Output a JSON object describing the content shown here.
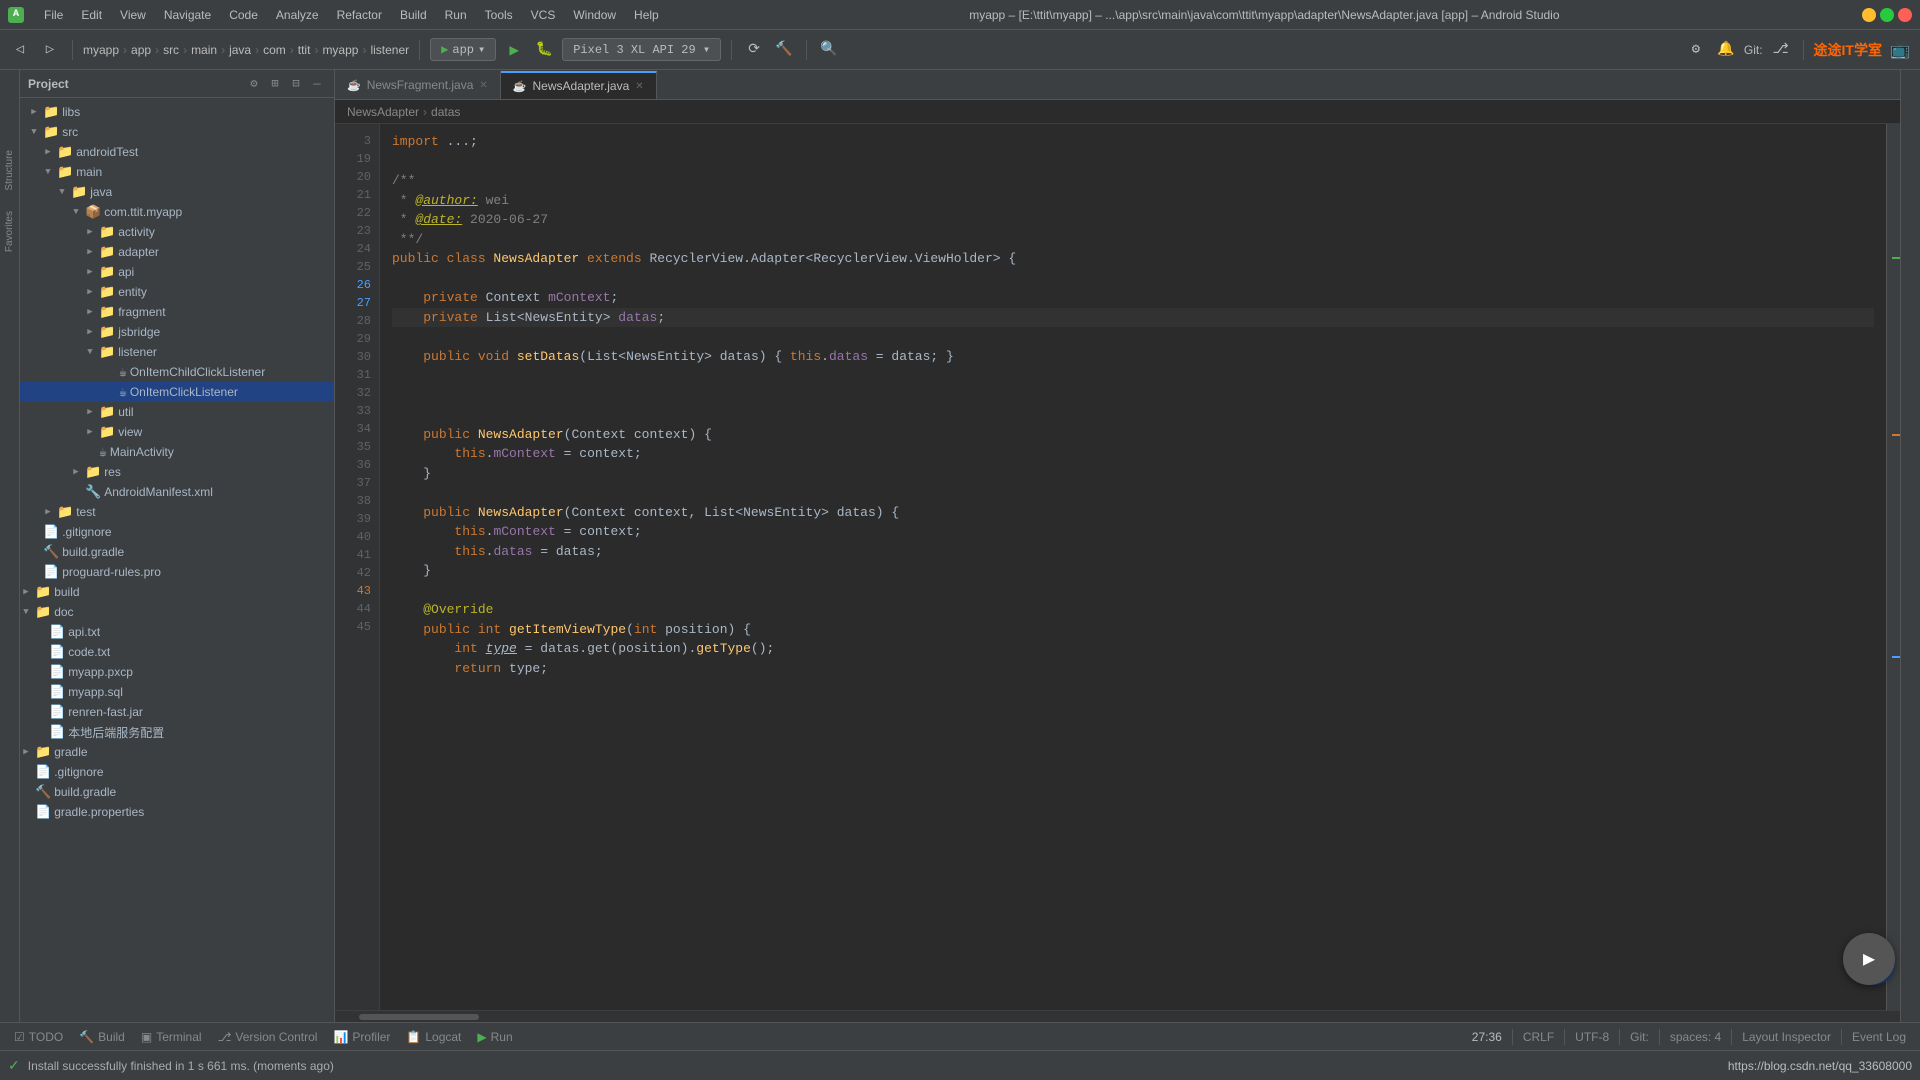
{
  "titlebar": {
    "menus": [
      "File",
      "Edit",
      "View",
      "Navigate",
      "Code",
      "Analyze",
      "Refactor",
      "Build",
      "Run",
      "Tools",
      "VCS",
      "Window",
      "Help"
    ],
    "title": "myapp – [E:\\ttit\\myapp] – ...\\app\\src\\main\\java\\com\\ttit\\myapp\\adapter\\NewsAdapter.java [app] – Android Studio",
    "wc_min": "—",
    "wc_max": "□",
    "wc_close": "✕"
  },
  "toolbar": {
    "app_config": "app",
    "device": "Pixel 3 XL API 29",
    "git_label": "Git:",
    "breadcrumb": [
      "myapp",
      "app",
      "src",
      "main",
      "java",
      "com",
      "ttit",
      "myapp",
      "listener"
    ]
  },
  "tabs": [
    {
      "name": "NewsFragment.java",
      "active": false,
      "modified": false
    },
    {
      "name": "NewsAdapter.java",
      "active": true,
      "modified": false
    }
  ],
  "code_breadcrumb": {
    "parts": [
      "NewsAdapter",
      "datas"
    ]
  },
  "sidebar": {
    "title": "Project",
    "tree": [
      {
        "indent": 0,
        "type": "folder",
        "expanded": true,
        "name": "libs",
        "icon": "📁"
      },
      {
        "indent": 0,
        "type": "folder",
        "expanded": true,
        "name": "src",
        "icon": "📁"
      },
      {
        "indent": 1,
        "type": "folder",
        "expanded": true,
        "name": "androidTest",
        "icon": "📁"
      },
      {
        "indent": 1,
        "type": "folder",
        "expanded": true,
        "name": "main",
        "icon": "📁"
      },
      {
        "indent": 2,
        "type": "folder",
        "expanded": true,
        "name": "java",
        "icon": "📁"
      },
      {
        "indent": 3,
        "type": "folder",
        "expanded": true,
        "name": "com.ttit.myapp",
        "icon": "📦"
      },
      {
        "indent": 4,
        "type": "folder",
        "expanded": false,
        "name": "activity",
        "icon": "📁"
      },
      {
        "indent": 4,
        "type": "folder",
        "expanded": false,
        "name": "adapter",
        "icon": "📁"
      },
      {
        "indent": 4,
        "type": "folder",
        "expanded": false,
        "name": "api",
        "icon": "📁"
      },
      {
        "indent": 4,
        "type": "folder",
        "expanded": false,
        "name": "entity",
        "icon": "📁"
      },
      {
        "indent": 4,
        "type": "folder",
        "expanded": false,
        "name": "fragment",
        "icon": "📁"
      },
      {
        "indent": 4,
        "type": "folder",
        "expanded": false,
        "name": "jsbridge",
        "icon": "📁"
      },
      {
        "indent": 4,
        "type": "folder",
        "expanded": true,
        "name": "listener",
        "icon": "📁"
      },
      {
        "indent": 5,
        "type": "file",
        "name": "OnItemChildClickListener",
        "icon": "☕"
      },
      {
        "indent": 5,
        "type": "file",
        "name": "OnItemClickListener",
        "icon": "☕",
        "selected": true
      },
      {
        "indent": 4,
        "type": "folder",
        "expanded": false,
        "name": "util",
        "icon": "📁"
      },
      {
        "indent": 4,
        "type": "folder",
        "expanded": false,
        "name": "view",
        "icon": "📁"
      },
      {
        "indent": 4,
        "type": "file",
        "name": "MainActivity",
        "icon": "☕"
      },
      {
        "indent": 3,
        "type": "folder",
        "expanded": false,
        "name": "res",
        "icon": "📁"
      },
      {
        "indent": 3,
        "type": "file",
        "name": "AndroidManifest.xml",
        "icon": "🔧"
      },
      {
        "indent": 2,
        "type": "folder",
        "expanded": false,
        "name": "test",
        "icon": "📁"
      },
      {
        "indent": 1,
        "type": "file",
        "name": ".gitignore",
        "icon": "📄"
      },
      {
        "indent": 1,
        "type": "file",
        "name": "build.gradle",
        "icon": "🔨"
      },
      {
        "indent": 1,
        "type": "file",
        "name": "proguard-rules.pro",
        "icon": "📄"
      },
      {
        "indent": 0,
        "type": "folder",
        "expanded": false,
        "name": "build",
        "icon": "📁"
      },
      {
        "indent": 0,
        "type": "folder",
        "expanded": true,
        "name": "doc",
        "icon": "📁"
      },
      {
        "indent": 1,
        "type": "file",
        "name": "api.txt",
        "icon": "📄"
      },
      {
        "indent": 1,
        "type": "file",
        "name": "code.txt",
        "icon": "📄"
      },
      {
        "indent": 1,
        "type": "file",
        "name": "myapp.pxcp",
        "icon": "📄"
      },
      {
        "indent": 1,
        "type": "file",
        "name": "myapp.sql",
        "icon": "📄"
      },
      {
        "indent": 1,
        "type": "file",
        "name": "renren-fast.jar",
        "icon": "📄"
      },
      {
        "indent": 1,
        "type": "file",
        "name": "本地后端服务配置",
        "icon": "📄"
      },
      {
        "indent": 0,
        "type": "folder",
        "expanded": false,
        "name": "gradle",
        "icon": "📁"
      },
      {
        "indent": 0,
        "type": "file",
        "name": ".gitignore",
        "icon": "📄"
      },
      {
        "indent": 0,
        "type": "file",
        "name": "build.gradle",
        "icon": "🔨"
      },
      {
        "indent": 0,
        "type": "file",
        "name": "gradle.properties",
        "icon": "📄"
      }
    ]
  },
  "code": {
    "lines": [
      {
        "num": 3,
        "content": "import ...;"
      },
      {
        "num": 19,
        "content": ""
      },
      {
        "num": 20,
        "content": "/**"
      },
      {
        "num": 21,
        "content": " * @author: wei"
      },
      {
        "num": 22,
        "content": " * @date: 2020-06-27"
      },
      {
        "num": 23,
        "content": " **/"
      },
      {
        "num": 24,
        "content": "public class NewsAdapter extends RecyclerView.Adapter<RecyclerView.ViewHolder> {"
      },
      {
        "num": 25,
        "content": ""
      },
      {
        "num": 26,
        "content": "    private Context mContext;"
      },
      {
        "num": 27,
        "content": "    private List<NewsEntity> datas;"
      },
      {
        "num": 28,
        "content": ""
      },
      {
        "num": 29,
        "content": "    public void setDatas(List<NewsEntity> datas) { this.datas = datas; }"
      },
      {
        "num": 30,
        "content": ""
      },
      {
        "num": 31,
        "content": ""
      },
      {
        "num": 32,
        "content": ""
      },
      {
        "num": 33,
        "content": "    public NewsAdapter(Context context) {"
      },
      {
        "num": 34,
        "content": "        this.mContext = context;"
      },
      {
        "num": 35,
        "content": "    }"
      },
      {
        "num": 36,
        "content": ""
      },
      {
        "num": 37,
        "content": "    public NewsAdapter(Context context, List<NewsEntity> datas) {"
      },
      {
        "num": 38,
        "content": "        this.mContext = context;"
      },
      {
        "num": 39,
        "content": "        this.datas = datas;"
      },
      {
        "num": 40,
        "content": "    }"
      },
      {
        "num": 41,
        "content": ""
      },
      {
        "num": 42,
        "content": "    @Override"
      },
      {
        "num": 43,
        "content": "    public int getItemViewType(int position) {"
      },
      {
        "num": 44,
        "content": "        int type = datas.get(position).getType();"
      },
      {
        "num": 45,
        "content": "        return type;"
      }
    ]
  },
  "status_bar": {
    "todo": "TODO",
    "build": "Build",
    "terminal": "Terminal",
    "version_control": "Version Control",
    "profiler": "Profiler",
    "logcat": "Logcat",
    "run": "Run",
    "cursor_pos": "27:36",
    "line_ending": "CRLF",
    "encoding": "UTF-8",
    "git_info": "Git:",
    "status_msg": "Install successfully finished in 1 s 661 ms. (moments ago)"
  }
}
